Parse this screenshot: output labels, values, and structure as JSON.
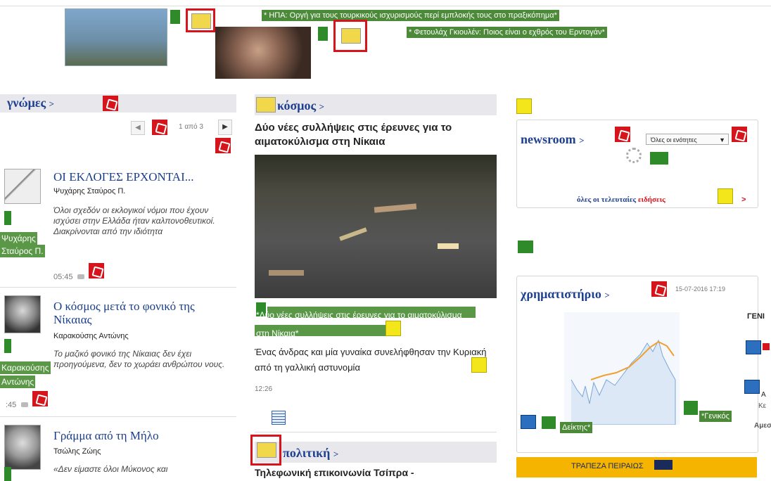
{
  "top": {
    "headline_1": "* ΗΠΑ: Οργή για τους τουρκικούς ισχυρισμούς περί εμπλοκής τους στο πραξικόπημα*",
    "headline_2": "* Φετουλάχ Γκιουλέν: Ποιος είναι ο εχθρός του Ερντογάν*"
  },
  "opinions": {
    "title": "γνώμες",
    "pager": "1 από 3",
    "items": [
      {
        "title": "ΟΙ ΕΚΛΟΓΕΣ ΕΡΧΟΝΤΑΙ...",
        "author": "Ψυχάρης Σταύρος Π.",
        "excerpt": "Όλοι σχεδόν οι εκλογικοί νόμοι που έχουν ισχύσει στην Ελλάδα ήταν καλπονοθευτικοί. Διακρίνονται από την ιδιότητα",
        "time": "05:45",
        "side_label_1": "Ψυχάρης",
        "side_label_2": "Σταύρος Π."
      },
      {
        "title": "Ο κόσμος μετά το φονικό της Νίκαιας",
        "author": "Καρακούσης Αντώνης",
        "excerpt": "Το μαζικό φονικό της Νίκαιας δεν έχει προηγούμενα, δεν το χωράει ανθρώπου νους.",
        "time": ":45",
        "side_label_1": "Καρακούσης",
        "side_label_2": "Αντώνης"
      },
      {
        "title": "Γράμμα από τη Μήλο",
        "author": "Τσώλης Ζώης",
        "excerpt": "«Δεν είμαστε όλοι Μύκονος και"
      }
    ]
  },
  "world": {
    "title": "κόσμος",
    "headline": "Δύο νέες συλλήψεις στις έρευνες για το αιματοκύλισμα στη Νίκαια",
    "caption": "*Δύο νέες συλλήψεις στις έρευνες για το αιματοκύλισμα στη Νίκαια*",
    "summary": "Ένας άνδρας και μία γυναίκα συνελήφθησαν την Κυριακή από τη γαλλική αστυνομία",
    "time": "12:26"
  },
  "politics": {
    "title": "πολιτική",
    "teaser": "Τηλεφωνική επικοινωνία Τσίπρα -"
  },
  "newsroom": {
    "title": "newsroom",
    "select_value": "Όλες οι ενότητες",
    "all_latest_prefix": "όλες οι τελευταίες ",
    "all_latest_link": "ειδήσεις"
  },
  "stocks": {
    "title": "χρηματιστήριο",
    "timestamp": "15-07-2016 17:19",
    "label_index": "Δείκτης*",
    "label_general": "*Γενικός",
    "side_general": "ΓΕΝΙ",
    "side_a": "Α",
    "side_ke": "Κε",
    "side_ame": "Αμεσ"
  },
  "bank": {
    "label": "ΤΡΑΠΕΖΑ ΠΕΙΡΑΙΩΣ"
  },
  "colors": {
    "accent_blue": "#1f3f8f",
    "alt_green": "#4c8a3a",
    "marker_red": "#d6141c",
    "bank_yellow": "#f5b400"
  }
}
